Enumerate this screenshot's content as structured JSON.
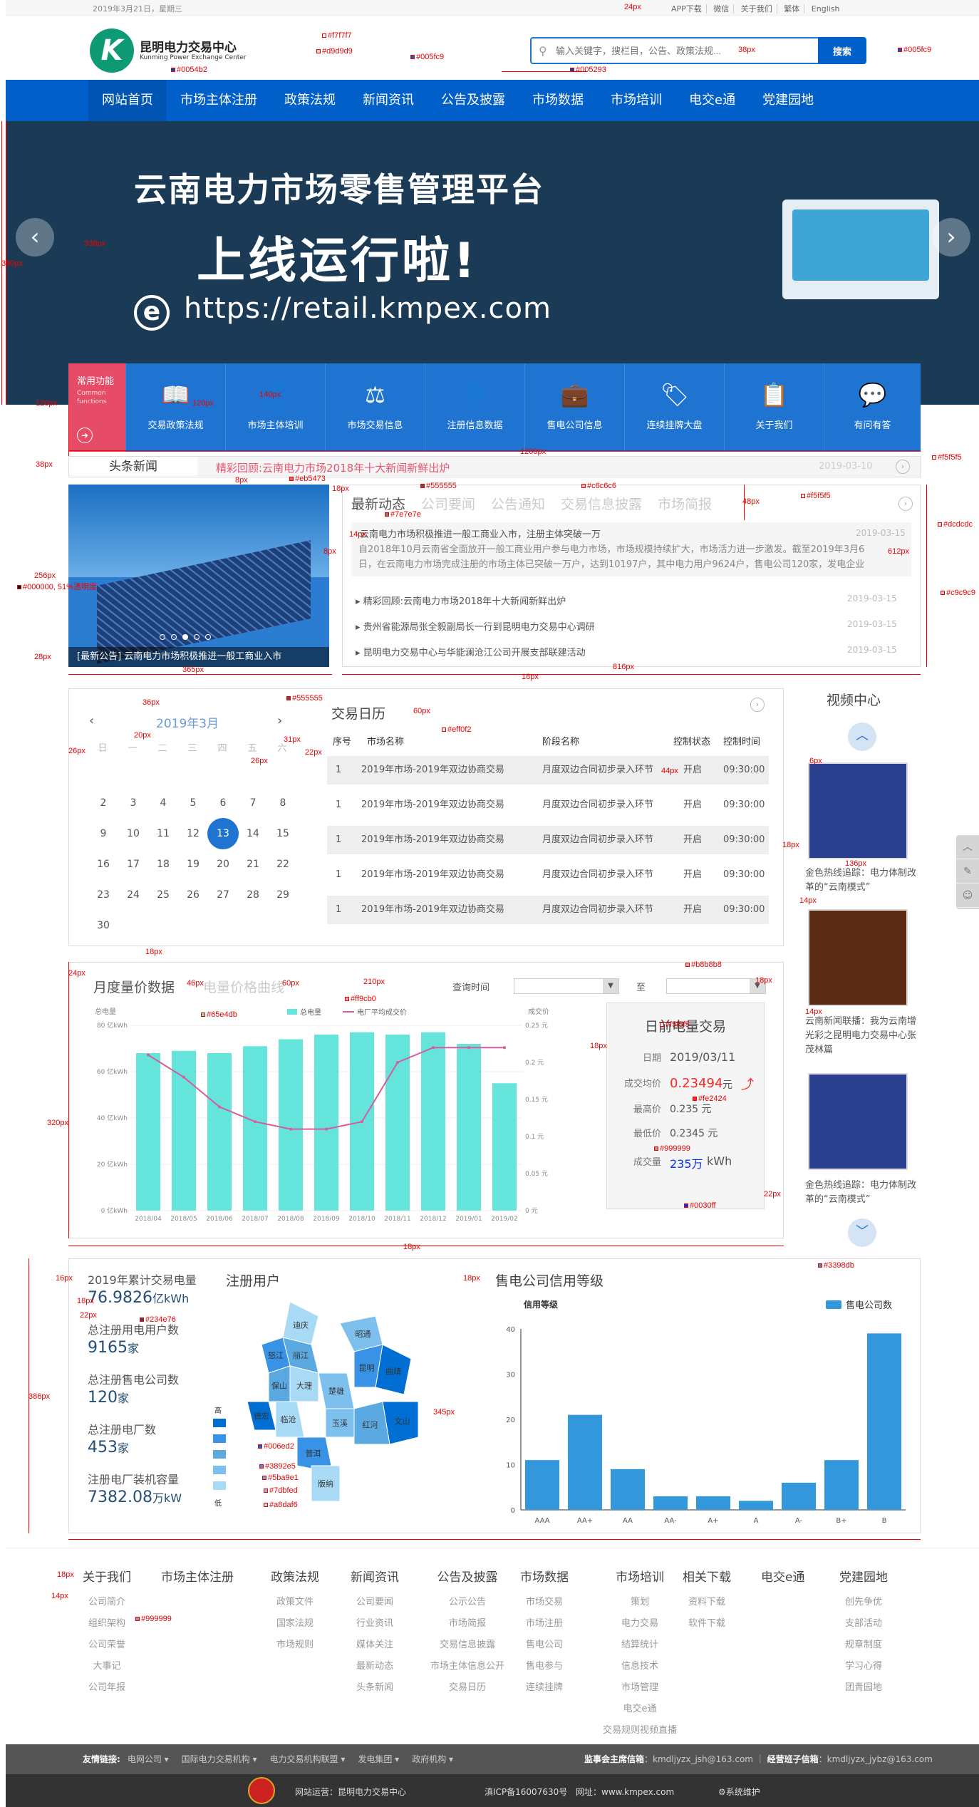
{
  "topbar": {
    "date": "2019年3月21日，星期三",
    "links": [
      "APP下载",
      "微信",
      "关于我们",
      "繁体",
      "English"
    ]
  },
  "header": {
    "logo_cn": "昆明电力交易中心",
    "logo_en": "Kunming Power Exchange Center",
    "search_placeholder": "输入关键字，搜栏目，公告、政策法规...",
    "search_button": "搜索"
  },
  "nav": [
    "网站首页",
    "市场主体注册",
    "政策法规",
    "新闻资讯",
    "公告及披露",
    "市场数据",
    "市场培训",
    "电交e通",
    "党建园地"
  ],
  "banner": {
    "line1": "云南电力市场零售管理平台",
    "line2": "上线运行啦!",
    "line3": "https://retail.kmpex.com"
  },
  "functions": {
    "title": "常用功能",
    "subtitle": "Common functions",
    "items": [
      {
        "label": "交易政策法规",
        "icon": "book-icon"
      },
      {
        "label": "市场主体培训",
        "icon": "trainer-icon"
      },
      {
        "label": "市场交易信息",
        "icon": "scale-icon"
      },
      {
        "label": "注册信息数据",
        "icon": "user-add-icon"
      },
      {
        "label": "售电公司信息",
        "icon": "briefcase-icon"
      },
      {
        "label": "连续挂牌大盘",
        "icon": "tag-icon"
      },
      {
        "label": "关于我们",
        "icon": "clipboard-icon"
      },
      {
        "label": "有问有答",
        "icon": "qa-icon"
      }
    ]
  },
  "ticker": {
    "head": "头条新闻",
    "text": "精彩回顾:云南电力市场2018年十大新闻新鲜出炉",
    "date": "2019-03-10"
  },
  "news": {
    "image_caption": "[最新公告] 云南电力市场积极推进一般工商业入市",
    "tabs": [
      "最新动态",
      "公司要闻",
      "公告通知",
      "交易信息披露",
      "市场简报"
    ],
    "hot_title": "云南电力市场积极推进一般工商业入市，注册主体突破一万",
    "hot_date": "2019-03-15",
    "hot_desc": "自2018年10月云南省全面放开一般工商业用户参与电力市场，市场规模持续扩大，市场活力进一步激发。截至2019年3月6日，在云南电力市场完成注册的市场主体已突破一万户，达到10197户，其中电力用户9624户，售电公司120家，发电企业",
    "items": [
      {
        "title": "精彩回顾:云南电力市场2018年十大新闻新鲜出炉",
        "date": "2019-03-15"
      },
      {
        "title": "贵州省能源局张全毅副局长一行到昆明电力交易中心调研",
        "date": "2019-03-15"
      },
      {
        "title": "昆明电力交易中心与华能澜沧江公司开展支部联建活动",
        "date": "2019-03-15"
      }
    ]
  },
  "calendar": {
    "year_month": "2019年3月",
    "weekdays": [
      "日",
      "一",
      "二",
      "三",
      "四",
      "五",
      "六"
    ],
    "days": [
      "2",
      "3",
      "4",
      "5",
      "6",
      "7",
      "8",
      "9",
      "10",
      "11",
      "12",
      "13",
      "14",
      "15",
      "16",
      "17",
      "18",
      "19",
      "20",
      "21",
      "22",
      "23",
      "24",
      "25",
      "26",
      "27",
      "28",
      "29",
      "30"
    ],
    "today": "13",
    "title": "交易日历",
    "headers": [
      "序号",
      "市场名称",
      "阶段名称",
      "控制状态",
      "控制时间"
    ],
    "rows": [
      [
        "1",
        "2019年市场-2019年双边协商交易",
        "月度双边合同初步录入环节",
        "开启",
        "09:30:00"
      ],
      [
        "1",
        "2019年市场-2019年双边协商交易",
        "月度双边合同初步录入环节",
        "开启",
        "09:30:00"
      ],
      [
        "1",
        "2019年市场-2019年双边协商交易",
        "月度双边合同初步录入环节",
        "开启",
        "09:30:00"
      ],
      [
        "1",
        "2019年市场-2019年双边协商交易",
        "月度双边合同初步录入环节",
        "开启",
        "09:30:00"
      ],
      [
        "1",
        "2019年市场-2019年双边协商交易",
        "月度双边合同初步录入环节",
        "开启",
        "09:30:00"
      ]
    ]
  },
  "video": {
    "title": "视频中心",
    "items": [
      "金色热线追踪：电力体制改革的“云南模式”",
      "云南新闻联播：我为云南增光彩之昆明电力交易中心张茂林篇",
      "金色热线追踪：电力体制改革的“云南模式”"
    ]
  },
  "monthly": {
    "tabs": [
      "月度量价数据",
      "电量价格曲线"
    ],
    "query_label": "查询时间",
    "to_label": "至"
  },
  "daily": {
    "title": "日前电量交易",
    "rows": [
      {
        "k": "日期",
        "v": "2019/03/11"
      },
      {
        "k": "成交均价",
        "v": "0.23494",
        "unit": "元"
      },
      {
        "k": "最高价",
        "v": "0.235 元"
      },
      {
        "k": "最低价",
        "v": "0.2345 元"
      },
      {
        "k": "成交量",
        "v": "235万",
        "unit": "kWh"
      }
    ]
  },
  "stats": {
    "items": [
      {
        "label": "2019年累计交易电量",
        "value": "76.9826",
        "unit": "亿kWh"
      },
      {
        "label": "总注册用电用户数",
        "value": "9165",
        "unit": "家"
      },
      {
        "label": "总注册售电公司数",
        "value": "120",
        "unit": "家"
      },
      {
        "label": "总注册电厂数",
        "value": "453",
        "unit": "家"
      },
      {
        "label": "注册电厂装机容量",
        "value": "7382.08",
        "unit": "万kW"
      }
    ],
    "map_title": "注册用户",
    "map_legend_high": "高",
    "map_legend_low": "低",
    "map_regions": [
      "迪庆",
      "昭通",
      "丽江",
      "怒江",
      "曲靖",
      "大理",
      "楚雄",
      "保山",
      "昆明",
      "德宏",
      "临沧",
      "玉溪",
      "红河",
      "普洱",
      "文山",
      "版纳"
    ],
    "credit_title": "售电公司信用等级"
  },
  "colors": {
    "primary": "#005fc9",
    "nav_active": "#0054b2",
    "ticker": "#eb5473",
    "stat_value": "#234e76",
    "bar": "#65e4db",
    "line": "#d65c9e",
    "credit_bar": "#3398db",
    "price_red": "#fe2424",
    "volume_blue": "#0030ff"
  },
  "chart_data": [
    {
      "type": "bar",
      "title": "",
      "series": [
        {
          "name": "总电量",
          "values": [
            68,
            69,
            68,
            71,
            74,
            76,
            77,
            76,
            77,
            72,
            55
          ]
        },
        {
          "name": "电厂平均成交价",
          "values": [
            0.21,
            0.18,
            0.14,
            0.12,
            0.11,
            0.11,
            0.12,
            0.2,
            0.22,
            0.22,
            0.22
          ]
        }
      ],
      "categories": [
        "2018/04",
        "2018/05",
        "2018/06",
        "2018/07",
        "2018/08",
        "2018/09",
        "2018/10",
        "2018/11",
        "2018/12",
        "2019/01",
        "2019/02"
      ],
      "ylabel": "总电量",
      "y2label": "成交价",
      "ylim": [
        0,
        80
      ],
      "yticks": [
        "0 亿kWh",
        "20 亿kWh",
        "40 亿kWh",
        "60 亿kWh",
        "80 亿kWh"
      ],
      "y2lim": [
        0,
        0.25
      ],
      "y2ticks": [
        "0 元",
        "0.05 元",
        "0.1 元",
        "0.15 元",
        "0.2 元",
        "0.25 元"
      ]
    },
    {
      "type": "bar",
      "title": "信用等级",
      "series": [
        {
          "name": "售电公司数",
          "values": [
            11,
            21,
            9,
            3,
            3,
            2,
            6,
            11,
            39
          ]
        }
      ],
      "categories": [
        "AAA",
        "AA+",
        "AA",
        "AA-",
        "A+",
        "A",
        "A-",
        "B+",
        "B"
      ],
      "ylim": [
        0,
        40
      ],
      "yticks": [
        "0",
        "10",
        "20",
        "30",
        "40"
      ]
    }
  ],
  "footer": {
    "cols": [
      {
        "h": "关于我们",
        "items": [
          "公司简介",
          "组织架构",
          "公司荣誉",
          "大事记",
          "公司年报"
        ]
      },
      {
        "h": "市场主体注册",
        "items": []
      },
      {
        "h": "政策法规",
        "items": [
          "政策文件",
          "国家法规",
          "市场规则"
        ]
      },
      {
        "h": "新闻资讯",
        "items": [
          "公司要闻",
          "行业资讯",
          "媒体关注",
          "最新动态",
          "头条新闻"
        ]
      },
      {
        "h": "公告及披露",
        "items": [
          "公示公告",
          "市场简报",
          "交易信息披露",
          "市场主体信息公开",
          "交易日历"
        ]
      },
      {
        "h": "市场数据",
        "items": [
          "市场交易",
          "市场注册",
          "售电公司",
          "售电参与",
          "连续挂牌"
        ]
      },
      {
        "h": "市场培训",
        "items": [
          "策划",
          "电力交易",
          "结算统计",
          "信息技术",
          "市场管理",
          "电交e通",
          "交易规则视频直播"
        ]
      },
      {
        "h": "相关下载",
        "items": [
          "资料下载",
          "软件下载"
        ]
      },
      {
        "h": "电交e通",
        "items": []
      },
      {
        "h": "党建园地",
        "items": [
          "创先争优",
          "支部活动",
          "规章制度",
          "学习心得",
          "团青园地"
        ]
      }
    ],
    "friend_label": "友情链接:",
    "friends": [
      "电网公司 ▾",
      "国际电力交易机构 ▾",
      "电力交易机构联盟 ▾",
      "发电集团 ▾",
      "政府机构 ▾"
    ],
    "supervise": "监事会主席信箱",
    "supervise_mail": "kmdljyzx_jsh@163.com",
    "manager": "经营班子信箱",
    "manager_mail": "kmdljyzx_jybz@163.com",
    "operator": "网站运营：昆明电力交易中心",
    "icp": "滇ICP备16007630号",
    "site": "网址：www.kmpex.com",
    "maint": "系统维护"
  },
  "annotations": [
    {
      "t": "24px"
    },
    {
      "t": "#f7f7f7"
    },
    {
      "t": "#d9d9d9"
    },
    {
      "t": "#005fc9"
    },
    {
      "t": "#0054b2"
    },
    {
      "t": "38px"
    },
    {
      "t": "#005293"
    },
    {
      "t": "#005fc9"
    },
    {
      "t": "338px"
    },
    {
      "t": "390px"
    },
    {
      "t": "120px"
    },
    {
      "t": "120px"
    },
    {
      "t": "140px"
    },
    {
      "t": "1200px"
    },
    {
      "t": "38px"
    },
    {
      "t": "#f5f5f5"
    },
    {
      "t": "8px"
    },
    {
      "t": "#eb5473"
    },
    {
      "t": "18px"
    },
    {
      "t": "#555555"
    },
    {
      "t": "#7e7e7e"
    },
    {
      "t": "#c6c6c6"
    },
    {
      "t": "#f5f5f5"
    },
    {
      "t": "#dcdcdc"
    },
    {
      "t": "48px"
    },
    {
      "t": "14px"
    },
    {
      "t": "612px"
    },
    {
      "t": "8px"
    },
    {
      "t": "256px"
    },
    {
      "t": "#000000, 51%透明度"
    },
    {
      "t": "#c9c9c9"
    },
    {
      "t": "28px"
    },
    {
      "t": "365px"
    },
    {
      "t": "18px"
    },
    {
      "t": "816px"
    },
    {
      "t": "36px"
    },
    {
      "t": "#555555"
    },
    {
      "t": "60px"
    },
    {
      "t": "#eff0f2"
    },
    {
      "t": "20px"
    },
    {
      "t": "26px"
    },
    {
      "t": "31px"
    },
    {
      "t": "22px"
    },
    {
      "t": "26px"
    },
    {
      "t": "44px"
    },
    {
      "t": "18px"
    },
    {
      "t": "6px"
    },
    {
      "t": "136px"
    },
    {
      "t": "14px"
    },
    {
      "t": "14px"
    },
    {
      "t": "18px"
    },
    {
      "t": "24px"
    },
    {
      "t": "46px"
    },
    {
      "t": "60px"
    },
    {
      "t": "210px"
    },
    {
      "t": "#b8b8b8"
    },
    {
      "t": "18px"
    },
    {
      "t": "#65e4db"
    },
    {
      "t": "#ff9cb0"
    },
    {
      "t": "#f5f5f5"
    },
    {
      "t": "18px"
    },
    {
      "t": "320px"
    },
    {
      "t": "#fe2424"
    },
    {
      "t": "#999999"
    },
    {
      "t": "22px"
    },
    {
      "t": "#0030ff"
    },
    {
      "t": "18px"
    },
    {
      "t": "16px"
    },
    {
      "t": "18px"
    },
    {
      "t": "22px"
    },
    {
      "t": "#234e76"
    },
    {
      "t": "#3398db"
    },
    {
      "t": "18px"
    },
    {
      "t": "386px"
    },
    {
      "t": "345px"
    },
    {
      "t": "#006ed2"
    },
    {
      "t": "#3892e5"
    },
    {
      "t": "#5ba9e1"
    },
    {
      "t": "#7dbfed"
    },
    {
      "t": "#a8daf6"
    },
    {
      "t": "18px"
    },
    {
      "t": "14px"
    },
    {
      "t": "#999999"
    }
  ]
}
